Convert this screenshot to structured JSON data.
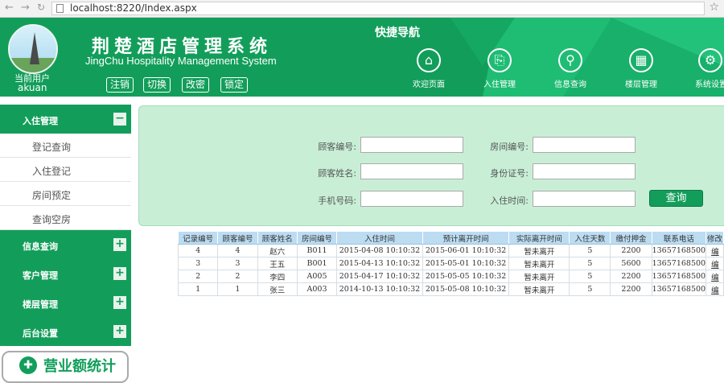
{
  "browser": {
    "url": "localhost:8220/Index.aspx",
    "back": "←",
    "forward": "→",
    "star": "☆"
  },
  "header": {
    "current_user_label": "当前用户",
    "username": "akuan",
    "title": "荆楚酒店管理系统",
    "subtitle": "JingChu Hospitality Management System",
    "buttons": [
      "注销",
      "切换",
      "改密",
      "锁定"
    ],
    "quick_nav_title": "快捷导航",
    "quick_nav": [
      {
        "label": "欢迎页面",
        "icon": "home-icon",
        "glyph": "⌂"
      },
      {
        "label": "入住管理",
        "icon": "checkin-icon",
        "glyph": "⎘"
      },
      {
        "label": "信息查询",
        "icon": "search-icon",
        "glyph": "⚲"
      },
      {
        "label": "楼层管理",
        "icon": "grid-icon",
        "glyph": "▦"
      },
      {
        "label": "系统设置",
        "icon": "gear-icon",
        "glyph": "⚙"
      }
    ]
  },
  "sidebar": {
    "sections": [
      {
        "label": "入住管理",
        "toggle": "−"
      },
      {
        "label": "信息查询",
        "toggle": "+"
      },
      {
        "label": "客户管理",
        "toggle": "+"
      },
      {
        "label": "楼层管理",
        "toggle": "+"
      },
      {
        "label": "后台设置",
        "toggle": "+"
      }
    ],
    "sub_items": [
      "登记查询",
      "入住登记",
      "房间预定",
      "查询空房"
    ],
    "revenue": {
      "label": "营业额统计",
      "icon": "plus-icon",
      "glyph": "✚"
    }
  },
  "search": {
    "fields": [
      {
        "label": "顾客编号:",
        "value": ""
      },
      {
        "label": "房间编号:",
        "value": ""
      },
      {
        "label": "顾客姓名:",
        "value": ""
      },
      {
        "label": "身份证号:",
        "value": ""
      },
      {
        "label": "手机号码:",
        "value": ""
      },
      {
        "label": "入住时间:",
        "value": ""
      }
    ],
    "button": "查询"
  },
  "table": {
    "headers": [
      "记录编号",
      "顾客编号",
      "顾客姓名",
      "房间编号",
      "入住时间",
      "预计离开时间",
      "实际离开时间",
      "入住天数",
      "缴付押金",
      "联系电话",
      "修改"
    ],
    "rows": [
      [
        "4",
        "4",
        "赵六",
        "B011",
        "2015-04-08 10:10:32",
        "2015-06-01 10:10:32",
        "暂未离开",
        "5",
        "2200",
        "13657168500",
        "编"
      ],
      [
        "3",
        "3",
        "王五",
        "B001",
        "2015-04-13 10:10:32",
        "2015-05-01 10:10:32",
        "暂未离开",
        "5",
        "5600",
        "13657168500",
        "编"
      ],
      [
        "2",
        "2",
        "李四",
        "A005",
        "2015-04-17 10:10:32",
        "2015-05-05 10:10:32",
        "暂未离开",
        "5",
        "2200",
        "13657168500",
        "编"
      ],
      [
        "1",
        "1",
        "张三",
        "A003",
        "2014-10-13 10:10:32",
        "2015-05-08 10:10:32",
        "暂未离开",
        "5",
        "2200",
        "13657168500",
        "编"
      ]
    ]
  }
}
